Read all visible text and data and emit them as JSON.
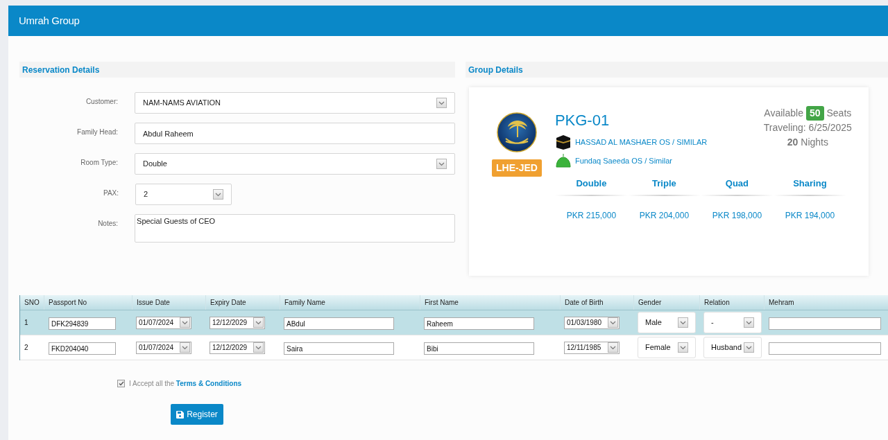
{
  "header": {
    "title": "Umrah Group"
  },
  "reservation": {
    "title": "Reservation Details",
    "fields": [
      {
        "label": "Customer:",
        "value": "NAM-NAMS AVIATION",
        "kind": "select"
      },
      {
        "label": "Family Head:",
        "value": "Abdul Raheem",
        "kind": "text"
      },
      {
        "label": "Room Type:",
        "value": "Double",
        "kind": "select"
      },
      {
        "label": "PAX:",
        "value": "2",
        "kind": "small-select"
      },
      {
        "label": "Notes:",
        "value": "Special Guests of CEO",
        "kind": "textarea"
      }
    ]
  },
  "group": {
    "title": "Group Details",
    "route": "LHE-JED",
    "code": "PKG-01",
    "hotels": [
      {
        "name": "HASSAD AL MASHAER OS / SIMILAR",
        "kind": "kaaba"
      },
      {
        "name": "Fundaq Saeeda OS / Similar",
        "kind": "dome"
      }
    ],
    "available_label": "Available",
    "seats": "50",
    "seats_label": "Seats",
    "traveling": "Traveling: 6/25/2025",
    "nights": "20",
    "nights_label": "Nights",
    "prices": [
      {
        "room": "Double",
        "price": "PKR 215,000"
      },
      {
        "room": "Triple",
        "price": "PKR 204,000"
      },
      {
        "room": "Quad",
        "price": "PKR 198,000"
      },
      {
        "room": "Sharing",
        "price": "PKR 194,000"
      }
    ]
  },
  "table": {
    "columns": [
      "SNO",
      "Passport No",
      "Issue Date",
      "Expiry Date",
      "Family Name",
      "First Name",
      "Date of Birth",
      "Gender",
      "Relation",
      "Mehram"
    ],
    "rows": [
      {
        "selected": true,
        "sno": "1",
        "passport": "DFK294839",
        "issue": "01/07/2024",
        "expiry": "12/12/2029",
        "family": "ABdul",
        "first": "Raheem",
        "dob": "01/03/1980",
        "gender": "Male",
        "relation": "-",
        "mehram": ""
      },
      {
        "selected": false,
        "sno": "2",
        "passport": "FKD204040",
        "issue": "01/07/2024",
        "expiry": "12/12/2029",
        "family": "Saira",
        "first": "Bibi",
        "dob": "12/11/1985",
        "gender": "Female",
        "relation": "Husband",
        "mehram": ""
      }
    ]
  },
  "terms": {
    "checked": true,
    "text": "I Accept all the ",
    "link": "Terms & Conditions"
  },
  "register_button": "Register"
}
